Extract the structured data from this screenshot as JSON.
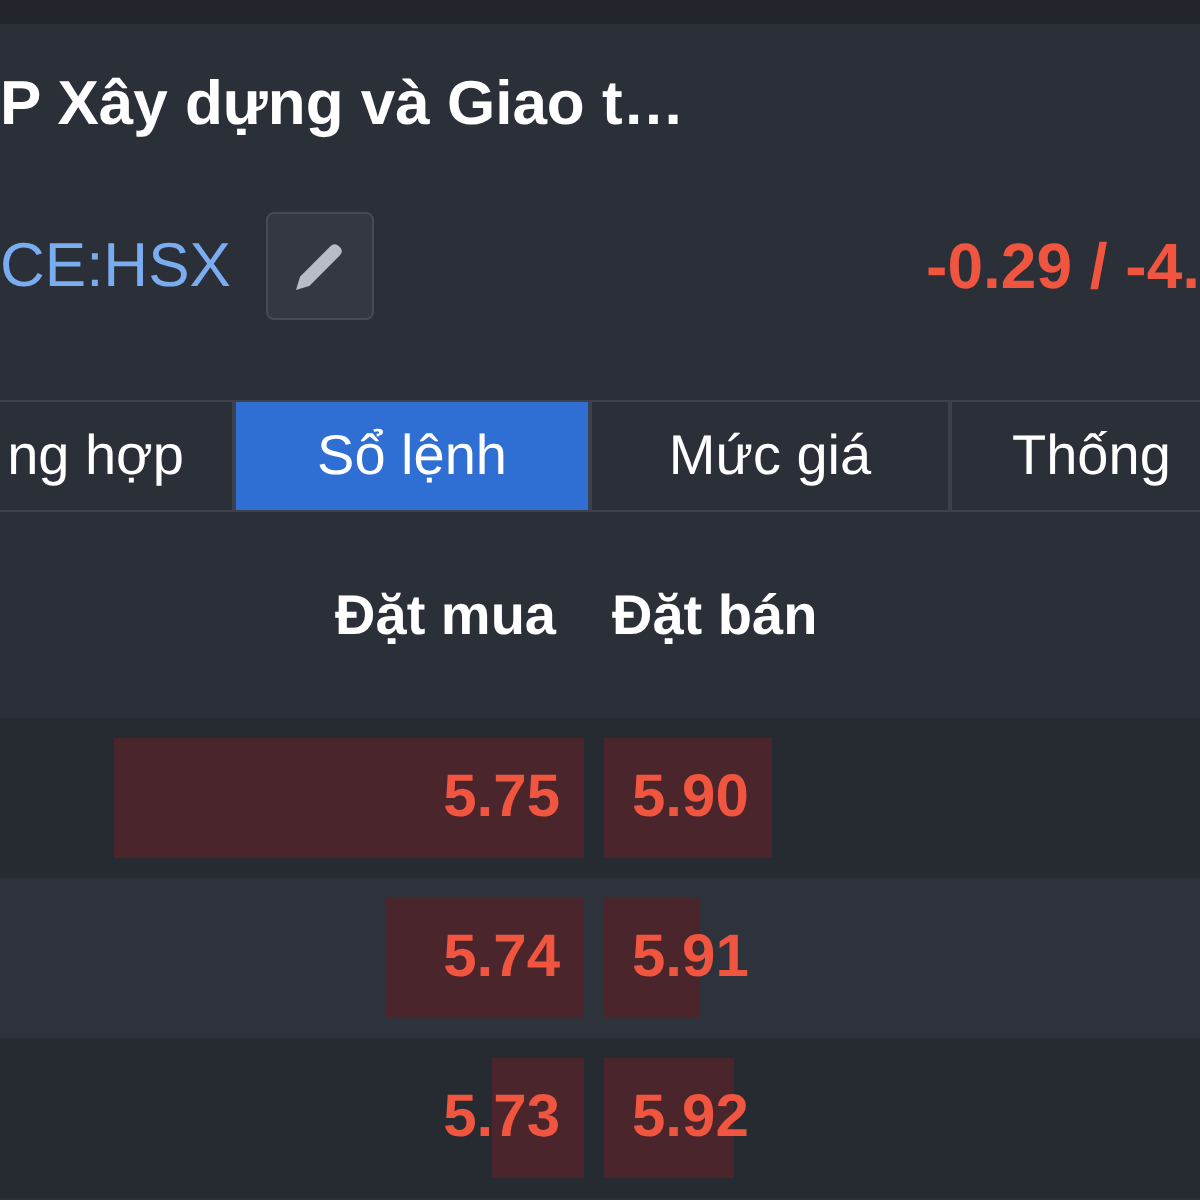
{
  "header": {
    "title": "P Xây dựng và Giao t…",
    "exchange": "CE:HSX",
    "change": "-0.29 / -4."
  },
  "tabs": [
    {
      "label": "ng hợp",
      "selected": false
    },
    {
      "label": "Sổ lệnh",
      "selected": true
    },
    {
      "label": "Mức giá",
      "selected": false
    },
    {
      "label": "Thống",
      "selected": false
    }
  ],
  "order_book": {
    "columns": [
      "Đặt mua",
      "Đặt bán"
    ],
    "rows": [
      {
        "bid": "5.75",
        "ask": "5.90"
      },
      {
        "bid": "5.74",
        "ask": "5.91"
      },
      {
        "bid": "5.73",
        "ask": "5.92"
      }
    ]
  }
}
